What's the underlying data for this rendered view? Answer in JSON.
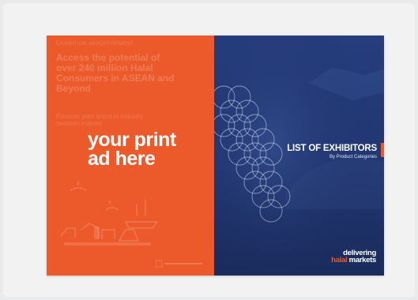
{
  "left_page": {
    "kicker": "exhibition advertisement",
    "faint_headline": "Access the potential of over 240 million Halal Consumers in ASEAN and Beyond",
    "faint_sub": "Promote your brand to industry decision makers",
    "headline_line1": "your print",
    "headline_line2": "ad here",
    "background_color": "#ec5a2c"
  },
  "right_page": {
    "title": "LIST OF EXHIBITORS",
    "subtitle": "By Product Categories",
    "brand_line1": "delivering",
    "brand_accent": "halal",
    "brand_rest": "markets",
    "background_color": "#233a78",
    "accent_color": "#ec5a2c"
  }
}
